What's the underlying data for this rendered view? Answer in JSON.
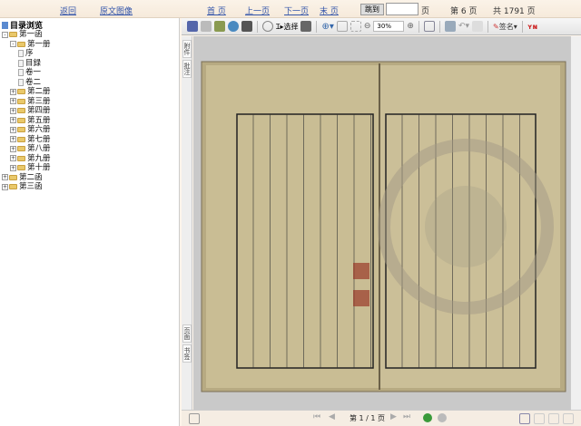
{
  "topbar": {
    "back": "返回",
    "image": "原文图像",
    "first": "首 页",
    "prev": "上一页",
    "next": "下一页",
    "last": "末 页",
    "goto": "跳到",
    "page_input": "",
    "page_unit": "页",
    "current_page": "第 6 页",
    "total_pages": "共 1791 页"
  },
  "tree": {
    "title": "目录浏览",
    "nodes": [
      {
        "label": "第一函",
        "level": 0,
        "type": "folder",
        "state": "-"
      },
      {
        "label": "第一册",
        "level": 1,
        "type": "folder",
        "state": "-"
      },
      {
        "label": "序",
        "level": 2,
        "type": "doc"
      },
      {
        "label": "目録",
        "level": 2,
        "type": "doc"
      },
      {
        "label": "卷一",
        "level": 2,
        "type": "doc"
      },
      {
        "label": "卷二",
        "level": 2,
        "type": "doc"
      },
      {
        "label": "第二册",
        "level": 1,
        "type": "folder",
        "state": "+"
      },
      {
        "label": "第三册",
        "level": 1,
        "type": "folder",
        "state": "+"
      },
      {
        "label": "第四册",
        "level": 1,
        "type": "folder",
        "state": "+"
      },
      {
        "label": "第五册",
        "level": 1,
        "type": "folder",
        "state": "+"
      },
      {
        "label": "第六册",
        "level": 1,
        "type": "folder",
        "state": "+"
      },
      {
        "label": "第七册",
        "level": 1,
        "type": "folder",
        "state": "+"
      },
      {
        "label": "第八册",
        "level": 1,
        "type": "folder",
        "state": "+"
      },
      {
        "label": "第九册",
        "level": 1,
        "type": "folder",
        "state": "+"
      },
      {
        "label": "第十册",
        "level": 1,
        "type": "folder",
        "state": "+"
      },
      {
        "label": "第二函",
        "level": 0,
        "type": "folder",
        "state": "+"
      },
      {
        "label": "第三函",
        "level": 0,
        "type": "folder",
        "state": "+"
      }
    ]
  },
  "toolbar": {
    "select": "选择",
    "zoom": "30%",
    "sign": "签名"
  },
  "sidetabs": [
    "附件",
    "批注",
    "页面",
    "书签"
  ],
  "bottombar": {
    "page_indicator": "第 1 / 1 页"
  }
}
